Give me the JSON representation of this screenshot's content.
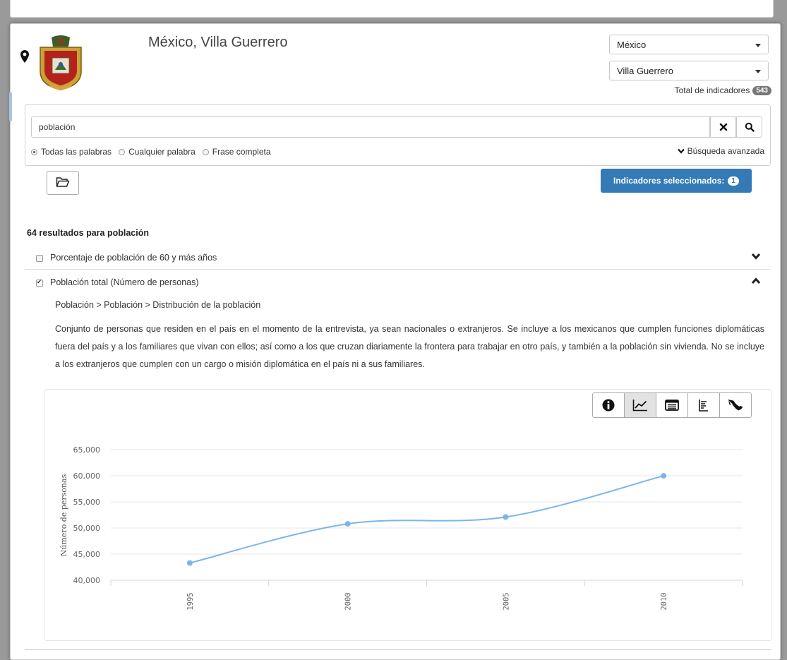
{
  "location": {
    "title": "México, Villa Guerrero",
    "state_select": "México",
    "municipality_select": "Villa Guerrero",
    "total_label": "Total de indicadores",
    "total_count": "543"
  },
  "search": {
    "query": "población",
    "options": [
      "Todas las palabras",
      "Cualquier palabra",
      "Frase completa"
    ],
    "selected_option": "Todas las palabras",
    "advanced_label": "Búsqueda avanzada"
  },
  "selected_indicators": {
    "label": "Indicadores seleccionados:",
    "count": "1"
  },
  "results": {
    "summary": "64 resultados para población",
    "items": [
      {
        "label": "Porcentaje de población de 60 y más años",
        "checked": false,
        "expanded": false
      },
      {
        "label": "Población total (Número de personas)",
        "checked": true,
        "expanded": true
      }
    ],
    "expanded": {
      "breadcrumb": "Población > Población > Distribución de la población",
      "description": "Conjunto de personas que residen en el país en el momento de la entrevista, ya sean nacionales o extranjeros. Se incluye a los mexicanos que cumplen funciones diplomáticas fuera del país y a los familiares que vivan con ellos; así como a los que cruzan diariamente la frontera para trabajar en otro país, y también a la población sin vivienda. No se incluye a los extranjeros que cumplen con un cargo o misión diplomática en el país ni a sus familiares."
    }
  },
  "chart_tools": {
    "icons": [
      "info-icon",
      "line-chart-icon",
      "table-icon",
      "bar-list-icon",
      "mexico-map-icon"
    ],
    "active": "line-chart-icon"
  },
  "colors": {
    "line": "#7cb5ec",
    "primary_button": "#337ab7"
  },
  "chart_data": {
    "type": "line",
    "x": [
      "1995",
      "2000",
      "2005",
      "2010"
    ],
    "values": [
      43300,
      50800,
      52100,
      59991
    ],
    "ylabel": "Número de personas",
    "ylim": [
      40000,
      65000
    ],
    "yticks": [
      "40,000",
      "45,000",
      "50,000",
      "55,000",
      "60,000",
      "65,000"
    ],
    "grid": true
  }
}
